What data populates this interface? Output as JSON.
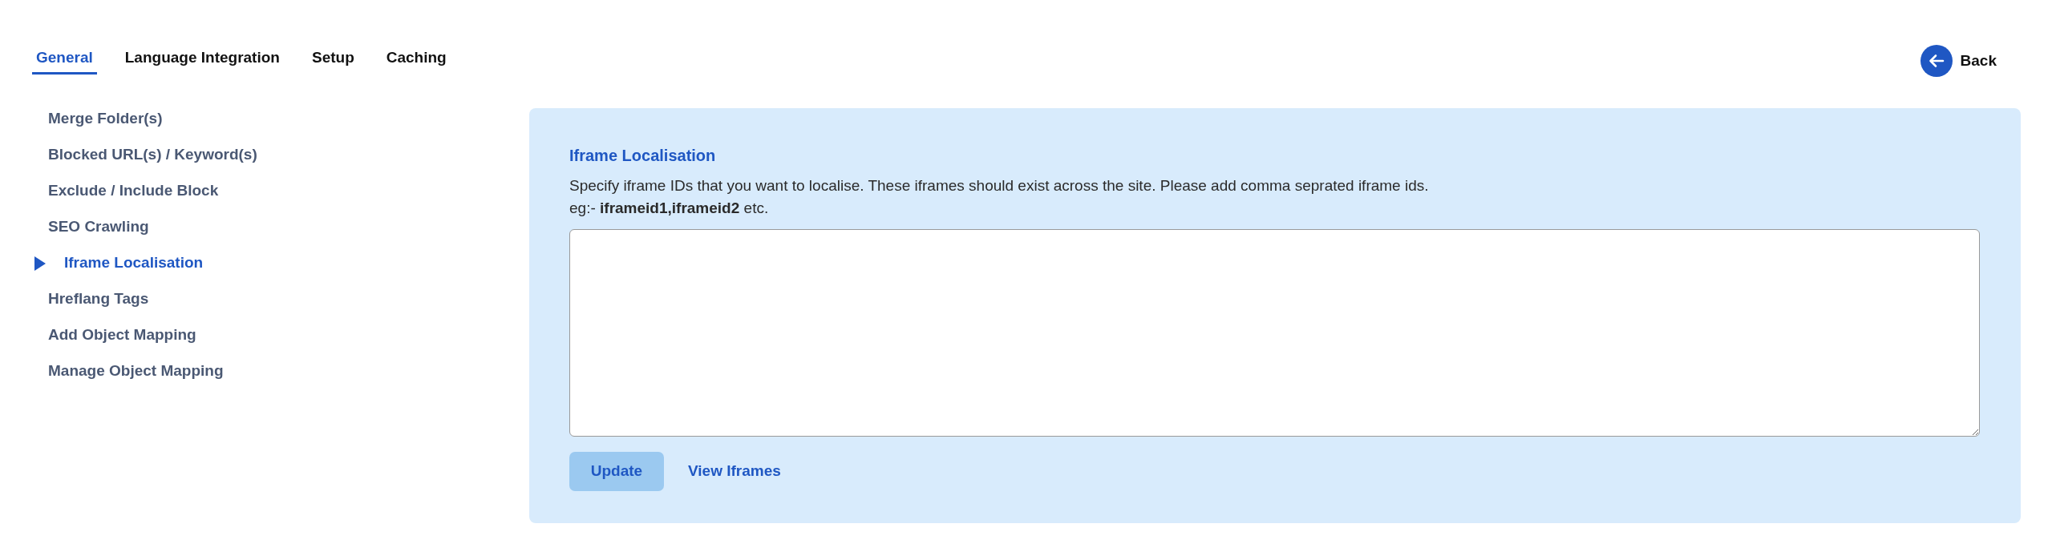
{
  "tabs": [
    {
      "label": "General",
      "selected": true
    },
    {
      "label": "Language Integration",
      "selected": false
    },
    {
      "label": "Setup",
      "selected": false
    },
    {
      "label": "Caching",
      "selected": false
    }
  ],
  "back_button": {
    "label": "Back"
  },
  "sidebar": {
    "items": [
      {
        "label": "Merge Folder(s)",
        "selected": false
      },
      {
        "label": "Blocked URL(s) / Keyword(s)",
        "selected": false
      },
      {
        "label": "Exclude / Include Block",
        "selected": false
      },
      {
        "label": "SEO Crawling",
        "selected": false
      },
      {
        "label": "Iframe Localisation",
        "selected": true
      },
      {
        "label": "Hreflang Tags",
        "selected": false
      },
      {
        "label": "Add Object Mapping",
        "selected": false
      },
      {
        "label": "Manage Object Mapping",
        "selected": false
      }
    ]
  },
  "panel": {
    "title": "Iframe Localisation",
    "description": "Specify iframe IDs that you want to localise. These iframes should exist across the site. Please add comma seprated iframe ids.",
    "example": "eg:- **iframeid1,iframeid2** etc.",
    "actions": [
      {
        "kind": "button",
        "label": "Update",
        "disabled": true
      },
      {
        "kind": "link",
        "label": "View Iframes"
      }
    ]
  }
}
